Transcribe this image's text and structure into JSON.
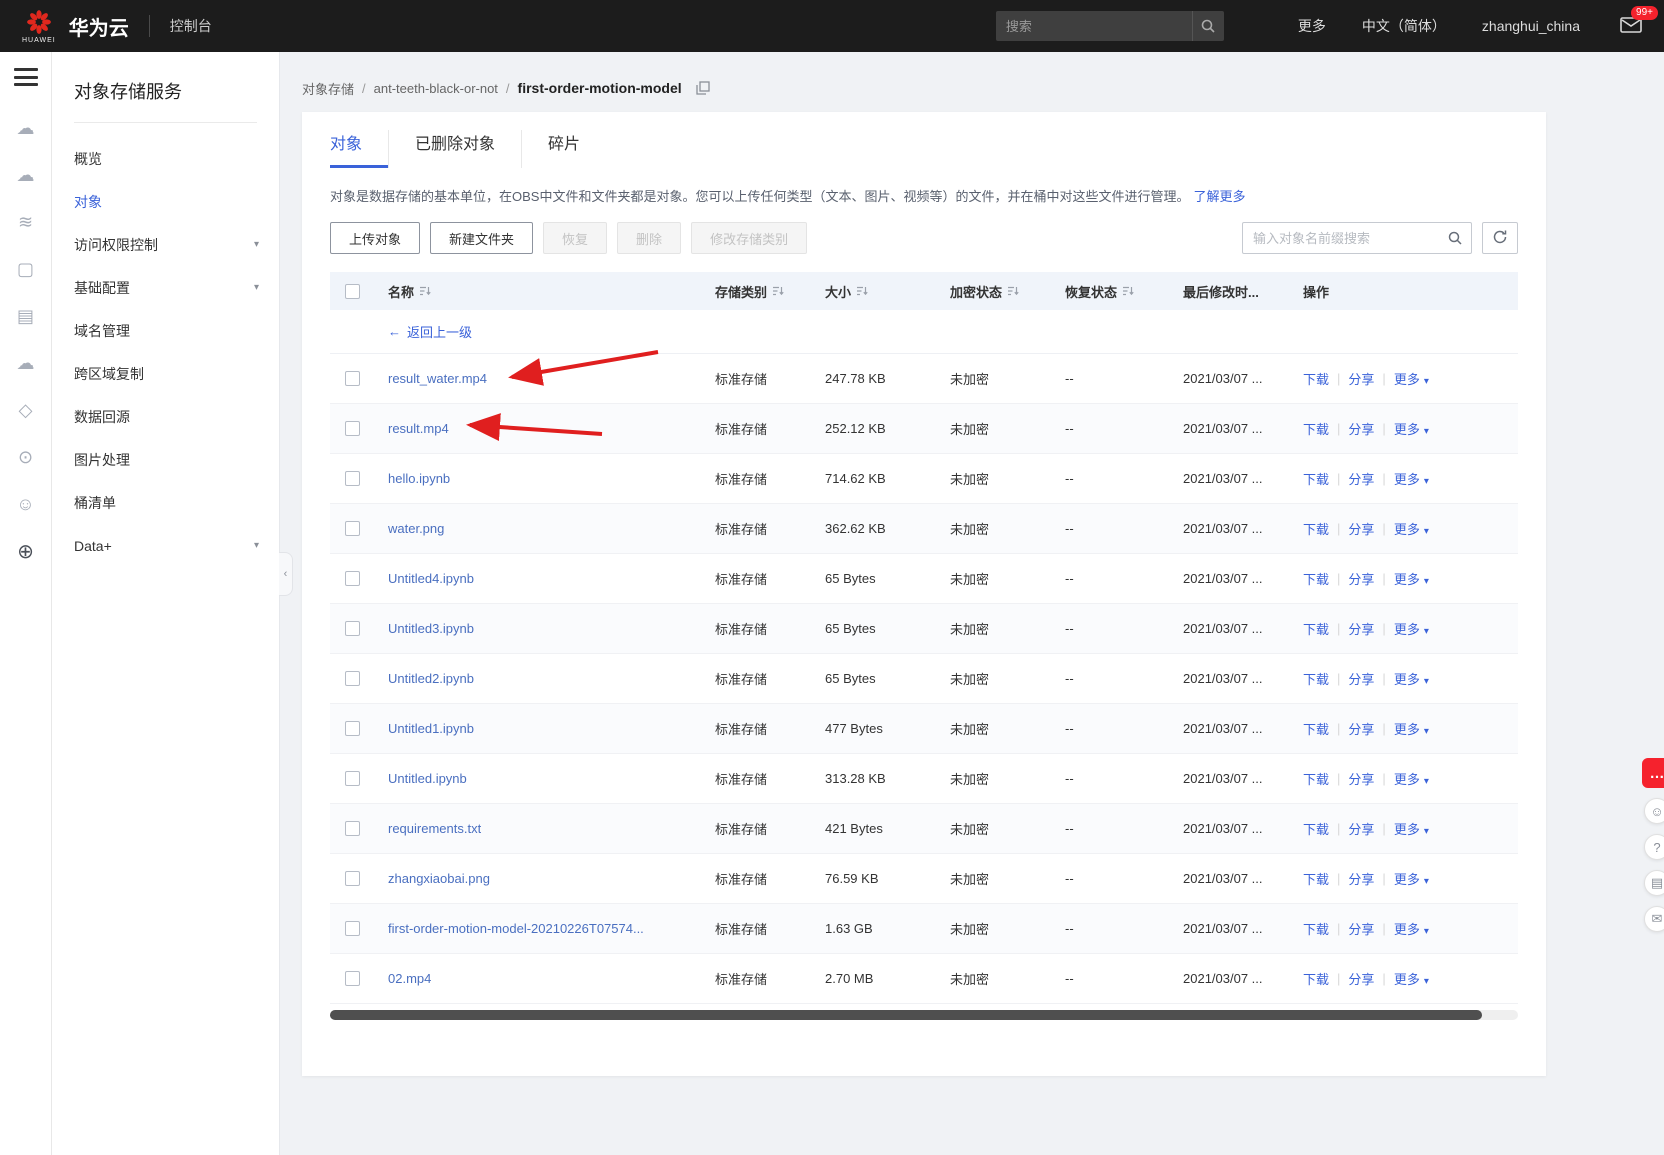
{
  "colors": {
    "accent": "#3a62d9",
    "link_blue": "#4a6fc0",
    "annotation_red": "#e01f1f",
    "badge_red": "#f5222d"
  },
  "topbar": {
    "brand_word": "HUAWEI",
    "brand_cn": "华为云",
    "console": "控制台",
    "search_placeholder": "搜索",
    "more": "更多",
    "language": "中文（简体）",
    "username": "zhanghui_china",
    "mail_badge": "99+"
  },
  "icon_strip": [
    {
      "name": "compute-cloud-icon",
      "glyph": "☁"
    },
    {
      "name": "storage-cloud-icon",
      "glyph": "☁"
    },
    {
      "name": "network-waves-icon",
      "glyph": "≋"
    },
    {
      "name": "server-icon",
      "glyph": "▢"
    },
    {
      "name": "billing-doc-icon",
      "glyph": "▤"
    },
    {
      "name": "cloud-service-icon",
      "glyph": "☁"
    },
    {
      "name": "lab-flask-icon",
      "glyph": "◇"
    },
    {
      "name": "ip-service-icon",
      "glyph": "⊙"
    },
    {
      "name": "user-group-icon",
      "glyph": "☺"
    },
    {
      "name": "globe-icon",
      "glyph": "⊕"
    }
  ],
  "sidebar": {
    "title": "对象存储服务",
    "items": [
      {
        "label": "概览"
      },
      {
        "label": "对象",
        "active": true
      },
      {
        "label": "访问权限控制",
        "caret": true
      },
      {
        "label": "基础配置",
        "caret": true
      },
      {
        "label": "域名管理"
      },
      {
        "label": "跨区域复制"
      },
      {
        "label": "数据回源"
      },
      {
        "label": "图片处理"
      },
      {
        "label": "桶清单"
      },
      {
        "label": "Data+",
        "caret": true
      }
    ]
  },
  "breadcrumb": {
    "root": "对象存储",
    "sep": "/",
    "bucket": "ant-teeth-black-or-not",
    "current": "first-order-motion-model"
  },
  "tabs": [
    {
      "label": "对象",
      "active": true
    },
    {
      "label": "已删除对象"
    },
    {
      "label": "碎片"
    }
  ],
  "intro": {
    "text": "对象是数据存储的基本单位，在OBS中文件和文件夹都是对象。您可以上传任何类型（文本、图片、视频等）的文件，并在桶中对这些文件进行管理。",
    "link": "了解更多"
  },
  "toolbar": {
    "upload": "上传对象",
    "new_folder": "新建文件夹",
    "restore": "恢复",
    "delete": "删除",
    "modify_class": "修改存储类别",
    "search_placeholder": "输入对象名前缀搜索"
  },
  "table": {
    "headers": [
      {
        "label": "名称",
        "sort": true
      },
      {
        "label": "存储类别",
        "sort": true
      },
      {
        "label": "大小",
        "sort": true
      },
      {
        "label": "加密状态",
        "sort": true
      },
      {
        "label": "恢复状态",
        "sort": true
      },
      {
        "label": "最后修改时..."
      },
      {
        "label": "操作"
      }
    ],
    "back_link": "返回上一级",
    "row_actions": {
      "download": "下载",
      "share": "分享",
      "more": "更多"
    },
    "rows": [
      {
        "name": "result_water.mp4",
        "storage_class": "标准存储",
        "size": "247.78 KB",
        "encryption": "未加密",
        "restore_status": "--",
        "modified": "2021/03/07 ..."
      },
      {
        "name": "result.mp4",
        "storage_class": "标准存储",
        "size": "252.12 KB",
        "encryption": "未加密",
        "restore_status": "--",
        "modified": "2021/03/07 ..."
      },
      {
        "name": "hello.ipynb",
        "storage_class": "标准存储",
        "size": "714.62 KB",
        "encryption": "未加密",
        "restore_status": "--",
        "modified": "2021/03/07 ..."
      },
      {
        "name": "water.png",
        "storage_class": "标准存储",
        "size": "362.62 KB",
        "encryption": "未加密",
        "restore_status": "--",
        "modified": "2021/03/07 ..."
      },
      {
        "name": "Untitled4.ipynb",
        "storage_class": "标准存储",
        "size": "65 Bytes",
        "encryption": "未加密",
        "restore_status": "--",
        "modified": "2021/03/07 ..."
      },
      {
        "name": "Untitled3.ipynb",
        "storage_class": "标准存储",
        "size": "65 Bytes",
        "encryption": "未加密",
        "restore_status": "--",
        "modified": "2021/03/07 ..."
      },
      {
        "name": "Untitled2.ipynb",
        "storage_class": "标准存储",
        "size": "65 Bytes",
        "encryption": "未加密",
        "restore_status": "--",
        "modified": "2021/03/07 ..."
      },
      {
        "name": "Untitled1.ipynb",
        "storage_class": "标准存储",
        "size": "477 Bytes",
        "encryption": "未加密",
        "restore_status": "--",
        "modified": "2021/03/07 ..."
      },
      {
        "name": "Untitled.ipynb",
        "storage_class": "标准存储",
        "size": "313.28 KB",
        "encryption": "未加密",
        "restore_status": "--",
        "modified": "2021/03/07 ..."
      },
      {
        "name": "requirements.txt",
        "storage_class": "标准存储",
        "size": "421 Bytes",
        "encryption": "未加密",
        "restore_status": "--",
        "modified": "2021/03/07 ..."
      },
      {
        "name": "zhangxiaobai.png",
        "storage_class": "标准存储",
        "size": "76.59 KB",
        "encryption": "未加密",
        "restore_status": "--",
        "modified": "2021/03/07 ..."
      },
      {
        "name": "first-order-motion-model-20210226T07574...",
        "storage_class": "标准存储",
        "size": "1.63 GB",
        "encryption": "未加密",
        "restore_status": "--",
        "modified": "2021/03/07 ..."
      },
      {
        "name": "02.mp4",
        "storage_class": "标准存储",
        "size": "2.70 MB",
        "encryption": "未加密",
        "restore_status": "--",
        "modified": "2021/03/07 ..."
      }
    ]
  },
  "floats": [
    {
      "name": "chat-widget-icon",
      "glyph": "…"
    },
    {
      "name": "smiley-feedback-icon",
      "glyph": "☺"
    },
    {
      "name": "help-icon",
      "glyph": "?"
    },
    {
      "name": "survey-doc-icon",
      "glyph": "▤"
    },
    {
      "name": "mail-feedback-icon",
      "glyph": "✉"
    }
  ]
}
